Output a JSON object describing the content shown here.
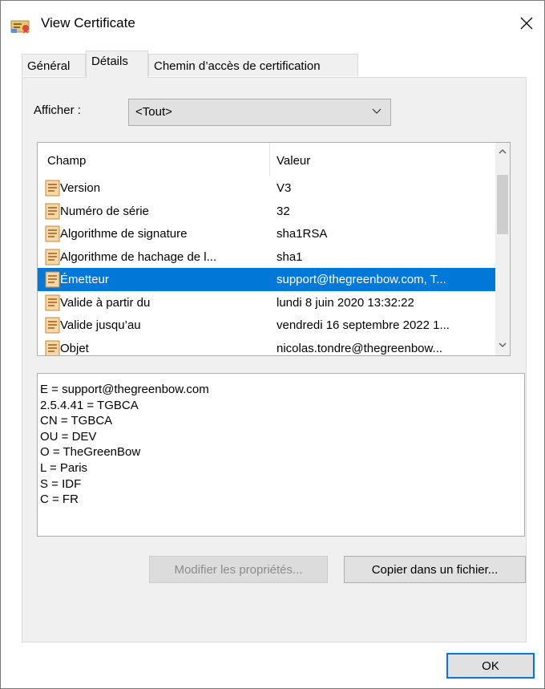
{
  "window": {
    "title": "View Certificate",
    "icon": "certificate-icon",
    "close_icon": "close-icon"
  },
  "tabs": [
    {
      "label": "Général",
      "active": false
    },
    {
      "label": "Détails",
      "active": true
    },
    {
      "label": "Chemin d’accès de certification",
      "active": false
    }
  ],
  "show": {
    "label": "Afficher :",
    "selected": "<Tout>"
  },
  "list": {
    "columns": [
      "Champ",
      "Valeur"
    ],
    "rows": [
      {
        "field": "Version",
        "value": "V3",
        "selected": false
      },
      {
        "field": "Numéro de série",
        "value": "32",
        "selected": false
      },
      {
        "field": "Algorithme de signature",
        "value": "sha1RSA",
        "selected": false
      },
      {
        "field": "Algorithme de hachage de l...",
        "value": "sha1",
        "selected": false
      },
      {
        "field": "Émetteur",
        "value": "support@thegreenbow.com, T...",
        "selected": true
      },
      {
        "field": "Valide à partir du",
        "value": "lundi 8 juin 2020 13:32:22",
        "selected": false
      },
      {
        "field": "Valide jusqu’au",
        "value": "vendredi 16 septembre 2022 1...",
        "selected": false
      },
      {
        "field": "Objet",
        "value": "nicolas.tondre@thegreenbow...",
        "selected": false
      }
    ]
  },
  "detail_lines": [
    "E = support@thegreenbow.com",
    "2.5.4.41 = TGBCA",
    "CN = TGBCA",
    "OU = DEV",
    "O = TheGreenBow",
    "L = Paris",
    "S = IDF",
    "C = FR"
  ],
  "buttons": {
    "modify": "Modifier les propriétés...",
    "copy": "Copier dans un fichier...",
    "ok": "OK"
  },
  "colors": {
    "selection": "#0078d7",
    "panel": "#f0f0f0",
    "button": "#e1e1e1"
  }
}
